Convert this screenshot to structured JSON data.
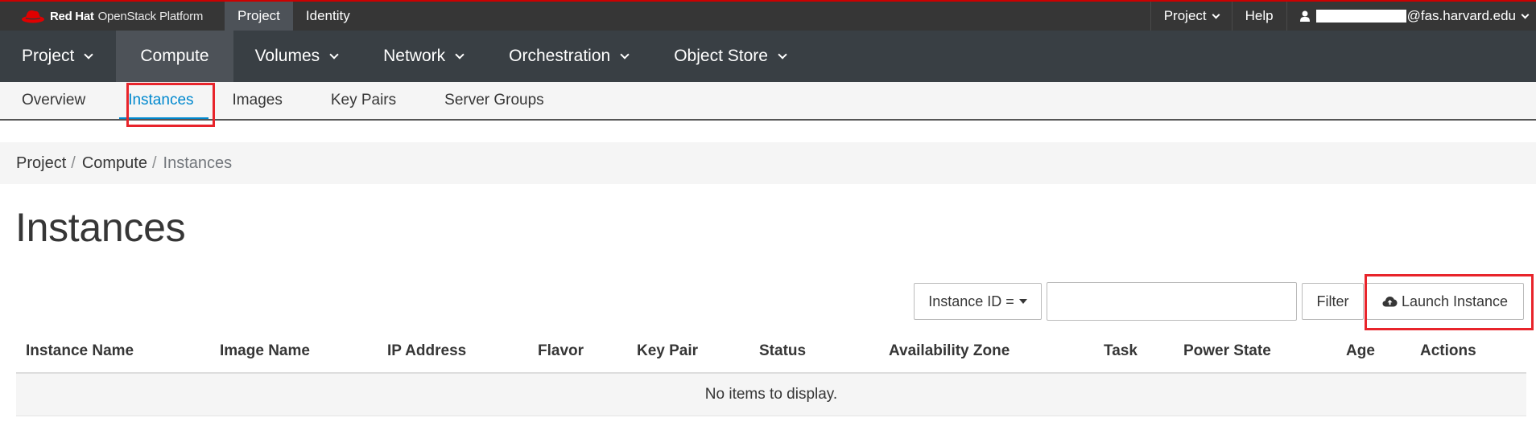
{
  "topbar": {
    "brand_bold": "Red Hat",
    "brand_light": "OpenStack Platform",
    "tabs": [
      {
        "label": "Project",
        "active": true
      },
      {
        "label": "Identity",
        "active": false
      }
    ],
    "right": {
      "project_menu": "Project",
      "help": "Help",
      "user_suffix": "@fas.harvard.edu"
    }
  },
  "mainnav": {
    "items": [
      {
        "label": "Project",
        "dropdown": true,
        "active": false
      },
      {
        "label": "Compute",
        "dropdown": false,
        "active": true
      },
      {
        "label": "Volumes",
        "dropdown": true,
        "active": false
      },
      {
        "label": "Network",
        "dropdown": true,
        "active": false
      },
      {
        "label": "Orchestration",
        "dropdown": true,
        "active": false
      },
      {
        "label": "Object Store",
        "dropdown": true,
        "active": false
      }
    ]
  },
  "subnav": {
    "items": [
      {
        "label": "Overview",
        "active": false
      },
      {
        "label": "Instances",
        "active": true
      },
      {
        "label": "Images",
        "active": false
      },
      {
        "label": "Key Pairs",
        "active": false
      },
      {
        "label": "Server Groups",
        "active": false
      }
    ]
  },
  "breadcrumb": {
    "items": [
      "Project",
      "Compute",
      "Instances"
    ],
    "separator": "/"
  },
  "page": {
    "title": "Instances"
  },
  "filter": {
    "field_label": "Instance ID =",
    "input_value": "",
    "filter_button": "Filter",
    "launch_button": "Launch Instance"
  },
  "table": {
    "columns": [
      "Instance Name",
      "Image Name",
      "IP Address",
      "Flavor",
      "Key Pair",
      "Status",
      "Availability Zone",
      "Task",
      "Power State",
      "Age",
      "Actions"
    ],
    "empty_message": "No items to display."
  },
  "colors": {
    "accent": "#0088ce",
    "highlight": "#e8242b",
    "topbar_bg": "#363636",
    "nav_bg": "#393f44"
  }
}
